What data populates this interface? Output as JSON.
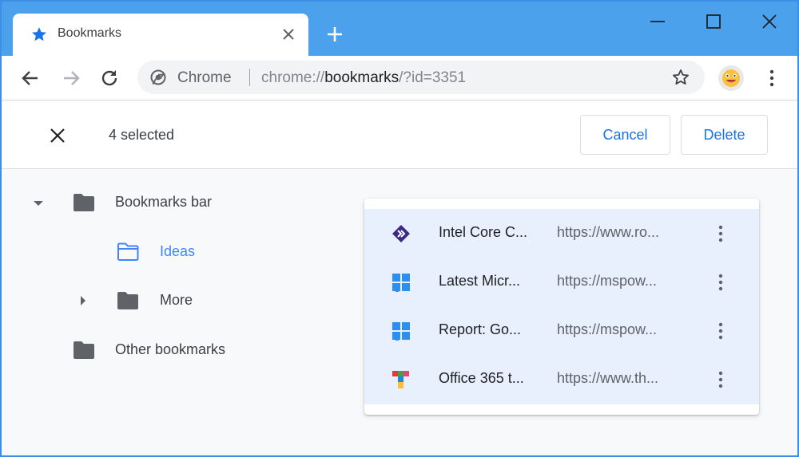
{
  "window": {
    "tab": {
      "title": "Bookmarks",
      "icon": "star-icon"
    },
    "controls": [
      "minimize-icon",
      "maximize-icon",
      "close-icon"
    ],
    "colors": {
      "titlebar": "#4ba1eb",
      "accent": "#1a73e8",
      "selected_row": "#e8f0fe"
    }
  },
  "toolbar": {
    "omnibox": {
      "chip_label": "Chrome",
      "url_scheme": "chrome://",
      "url_host": "bookmarks",
      "url_path": "/?id=3351"
    }
  },
  "selection_bar": {
    "count_label": "4 selected",
    "cancel_label": "Cancel",
    "delete_label": "Delete"
  },
  "folders": [
    {
      "label": "Bookmarks bar",
      "expanded": true
    },
    {
      "label": "Ideas",
      "selected": true
    },
    {
      "label": "More",
      "expanded": false
    },
    {
      "label": "Other bookmarks"
    }
  ],
  "bookmarks": [
    {
      "title": "Intel Core C...",
      "url": "https://www.ro...",
      "favicon": "diamond-logo-icon"
    },
    {
      "title": "Latest Micr...",
      "url": "https://mspow...",
      "favicon": "windows-logo-icon"
    },
    {
      "title": "Report: Go...",
      "url": "https://mspow...",
      "favicon": "windows-logo-icon"
    },
    {
      "title": "Office 365 t...",
      "url": "https://www.th...",
      "favicon": "colorful-t-logo-icon"
    }
  ]
}
